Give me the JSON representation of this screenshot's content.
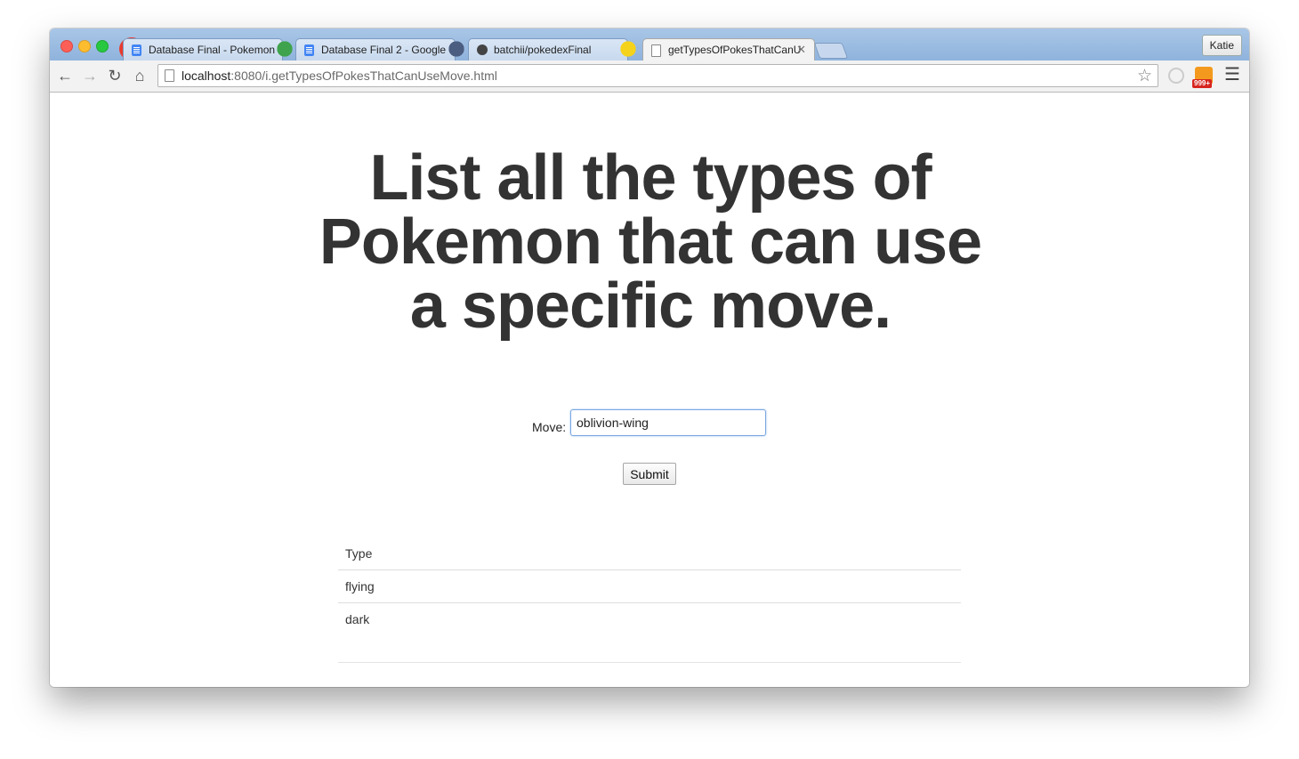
{
  "browser": {
    "tabs": [
      {
        "title": "Database Final - Pokemon",
        "favicon": "google-docs-icon",
        "active": false
      },
      {
        "title": "Database Final 2 - Google",
        "favicon": "google-docs-icon",
        "active": false
      },
      {
        "title": "batchii/pokedexFinal",
        "favicon": "github-icon",
        "active": false
      },
      {
        "title": "getTypesOfPokesThatCanU",
        "favicon": "page-icon",
        "active": true
      }
    ],
    "user": "Katie",
    "url_host": "localhost",
    "url_rest": ":8080/i.getTypesOfPokesThatCanUseMove.html",
    "rss_badge": "999+"
  },
  "page": {
    "title": "List all the types of Pokemon that can use a specific move.",
    "form": {
      "move_label": "Move:",
      "move_value": "oblivion-wing",
      "submit_label": "Submit"
    },
    "results": {
      "header": "Type",
      "rows": [
        "flying",
        "dark"
      ]
    }
  },
  "colors": {
    "heading": "#333333",
    "titlebar": "#8fb3dd",
    "input_focus": "#7aa7e0"
  }
}
